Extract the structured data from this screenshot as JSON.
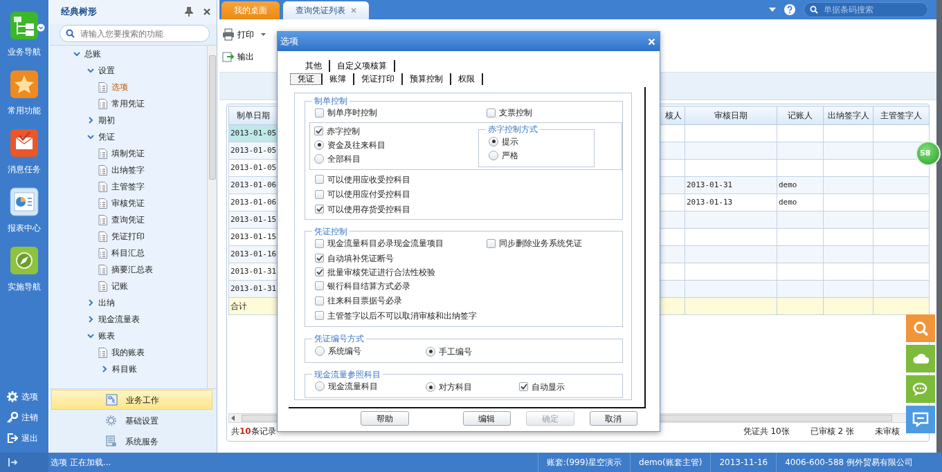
{
  "rail": {
    "nav": [
      {
        "label": "业务导航",
        "menu": true
      },
      {
        "label": "常用功能",
        "menu": false
      },
      {
        "label": "消息任务",
        "menu": false
      },
      {
        "label": "报表中心",
        "menu": false
      },
      {
        "label": "实施导航",
        "menu": false
      }
    ],
    "footer": [
      {
        "label": "选项"
      },
      {
        "label": "注销"
      },
      {
        "label": "退出"
      }
    ]
  },
  "tree_panel": {
    "title": "经典树形",
    "search": {
      "placeholder": "请输入您要搜索的功能"
    },
    "tree": [
      {
        "label": "总账",
        "expanded": true,
        "children": [
          {
            "label": "设置",
            "expanded": true,
            "children": [
              {
                "label": "选项",
                "selected": true
              },
              {
                "label": "常用凭证",
                "selected": false
              }
            ]
          },
          {
            "label": "期初",
            "expanded": false
          },
          {
            "label": "凭证",
            "expanded": true,
            "children": [
              {
                "label": "填制凭证",
                "selected": false
              },
              {
                "label": "出纳签字",
                "selected": false
              },
              {
                "label": "主管签字",
                "selected": false
              },
              {
                "label": "审核凭证",
                "selected": false
              },
              {
                "label": "查询凭证",
                "selected": false
              },
              {
                "label": "凭证打印",
                "selected": false
              },
              {
                "label": "科目汇总",
                "selected": false
              },
              {
                "label": "摘要汇总表",
                "selected": false
              },
              {
                "label": "记账",
                "selected": false
              }
            ]
          },
          {
            "label": "出纳",
            "expanded": false
          },
          {
            "label": "现金流量表",
            "expanded": false
          },
          {
            "label": "账表",
            "expanded": true,
            "children": [
              {
                "label": "我的账表",
                "selected": false
              },
              {
                "label": "科目账",
                "expanded": false
              }
            ]
          }
        ]
      }
    ],
    "modules": [
      {
        "label": "业务工作",
        "selected": true
      },
      {
        "label": "基础设置",
        "selected": false
      },
      {
        "label": "系统服务",
        "selected": false
      }
    ]
  },
  "tabs": [
    {
      "label": "我的桌面",
      "selected": false,
      "closable": false
    },
    {
      "label": "查询凭证列表",
      "selected": true,
      "closable": true
    }
  ],
  "header_search": {
    "placeholder": "单据条码搜索"
  },
  "toolbar": [
    {
      "label": "打印",
      "menu": true
    },
    {
      "label": "输出",
      "menu": false
    }
  ],
  "table": {
    "columns": [
      "制单日期",
      "核人",
      "审核日期",
      "记账人",
      "出纳签字人",
      "主管签字人"
    ],
    "rows": [
      {
        "entry_date": "2013-01-05",
        "selected": true
      },
      {
        "entry_date": "2013-01-05",
        "selected": false
      },
      {
        "entry_date": "2013-01-05",
        "selected": false
      },
      {
        "entry_date": "2013-01-06",
        "review_date": "2013-01-31",
        "bookkeeper": "demo",
        "selected": false
      },
      {
        "entry_date": "2013-01-06",
        "review_date": "2013-01-13",
        "bookkeeper": "demo",
        "selected": false
      },
      {
        "entry_date": "2013-01-15",
        "selected": false
      },
      {
        "entry_date": "2013-01-15",
        "selected": false
      },
      {
        "entry_date": "2013-01-16",
        "selected": false
      },
      {
        "entry_date": "2013-01-31",
        "selected": false
      },
      {
        "entry_date": "2013-01-31",
        "selected": false
      }
    ],
    "total": {
      "label": "合计"
    },
    "count_text": "共**10**条记录",
    "stats": [
      "凭证共 10张",
      "已审核 2 张",
      "未审核"
    ]
  },
  "badge": "58",
  "dialog": {
    "title": "选项",
    "tab_rows": [
      [
        {
          "label": "其他",
          "selected": false
        },
        {
          "label": "自定义项核算",
          "selected": false
        }
      ],
      [
        {
          "label": "凭证",
          "selected": true
        },
        {
          "label": "账簿",
          "selected": false
        },
        {
          "label": "凭证打印",
          "selected": false
        },
        {
          "label": "预算控制",
          "selected": false
        },
        {
          "label": "权限",
          "selected": false
        }
      ]
    ],
    "groups": [
      {
        "title": "制单控制",
        "kind": "options",
        "rows": [
          {
            "kind": "line",
            "items": [
              {
                "kind": "checkbox",
                "label": "制单序时控制",
                "checked": false
              },
              {
                "kind": "checkbox",
                "label": "支票控制",
                "checked": false
              }
            ]
          },
          {
            "kind": "box",
            "items": [
              {
                "kind": "checkbox",
                "label": "赤字控制",
                "checked": true
              },
              {
                "kind": "radio",
                "label": "资金及往来科目",
                "selected": true
              },
              {
                "kind": "radio",
                "label": "全部科目",
                "selected": false
              }
            ],
            "subgroup": {
              "title": "赤字控制方式",
              "items": [
                {
                  "kind": "radio",
                  "label": "提示",
                  "selected": true
                },
                {
                  "kind": "radio",
                  "label": "严格",
                  "selected": false
                }
              ]
            }
          },
          {
            "kind": "line",
            "items": [
              {
                "kind": "checkbox",
                "label": "可以使用应收受控科目",
                "checked": false
              }
            ]
          },
          {
            "kind": "line",
            "items": [
              {
                "kind": "checkbox",
                "label": "可以使用应付受控科目",
                "checked": false
              }
            ]
          },
          {
            "kind": "line",
            "items": [
              {
                "kind": "checkbox",
                "label": "可以使用存货受控科目",
                "checked": true
              }
            ]
          }
        ]
      },
      {
        "title": "凭证控制",
        "kind": "options",
        "rows": [
          {
            "kind": "line",
            "items": [
              {
                "kind": "checkbox",
                "label": "现金流量科目必录现金流量项目",
                "checked": false
              },
              {
                "kind": "checkbox",
                "label": "同步删除业务系统凭证",
                "checked": false
              }
            ]
          },
          {
            "kind": "line",
            "items": [
              {
                "kind": "checkbox",
                "label": "自动填补凭证断号",
                "checked": true
              }
            ]
          },
          {
            "kind": "line",
            "items": [
              {
                "kind": "checkbox",
                "label": "批量审核凭证进行合法性校验",
                "checked": true
              }
            ]
          },
          {
            "kind": "line",
            "items": [
              {
                "kind": "checkbox",
                "label": "银行科目结算方式必录",
                "checked": false
              }
            ]
          },
          {
            "kind": "line",
            "items": [
              {
                "kind": "checkbox",
                "label": "往来科目票据号必录",
                "checked": false
              }
            ]
          },
          {
            "kind": "line",
            "items": [
              {
                "kind": "checkbox",
                "label": "主管签字以后不可以取消审核和出纳签字",
                "checked": false
              }
            ]
          }
        ]
      },
      {
        "title": "凭证编号方式",
        "kind": "choice",
        "rows": [
          {
            "kind": "line",
            "items": [
              {
                "kind": "radio",
                "label": "系统编号",
                "selected": false
              },
              {
                "kind": "radio",
                "label": "手工编号",
                "selected": true
              }
            ]
          }
        ]
      },
      {
        "title": "现金流量参照科目",
        "kind": "choice",
        "rows": [
          {
            "kind": "line",
            "items": [
              {
                "kind": "radio",
                "label": "现金流量科目",
                "selected": false
              },
              {
                "kind": "radio",
                "label": "对方科目",
                "selected": true
              },
              {
                "kind": "checkbox",
                "label": "自动显示",
                "checked": true
              }
            ]
          }
        ]
      }
    ],
    "buttons": [
      {
        "label": "帮助",
        "disabled": false
      },
      {
        "label": "编辑",
        "disabled": false
      },
      {
        "label": "确定",
        "disabled": true
      },
      {
        "label": "取消",
        "disabled": false
      }
    ]
  },
  "status_bar": {
    "message": "选项 正在加载...",
    "items": [
      "账套:(999)星空演示",
      "demo(账套主管)",
      "2013-11-16",
      "4006-600-588 例外贸易有限公司"
    ]
  }
}
